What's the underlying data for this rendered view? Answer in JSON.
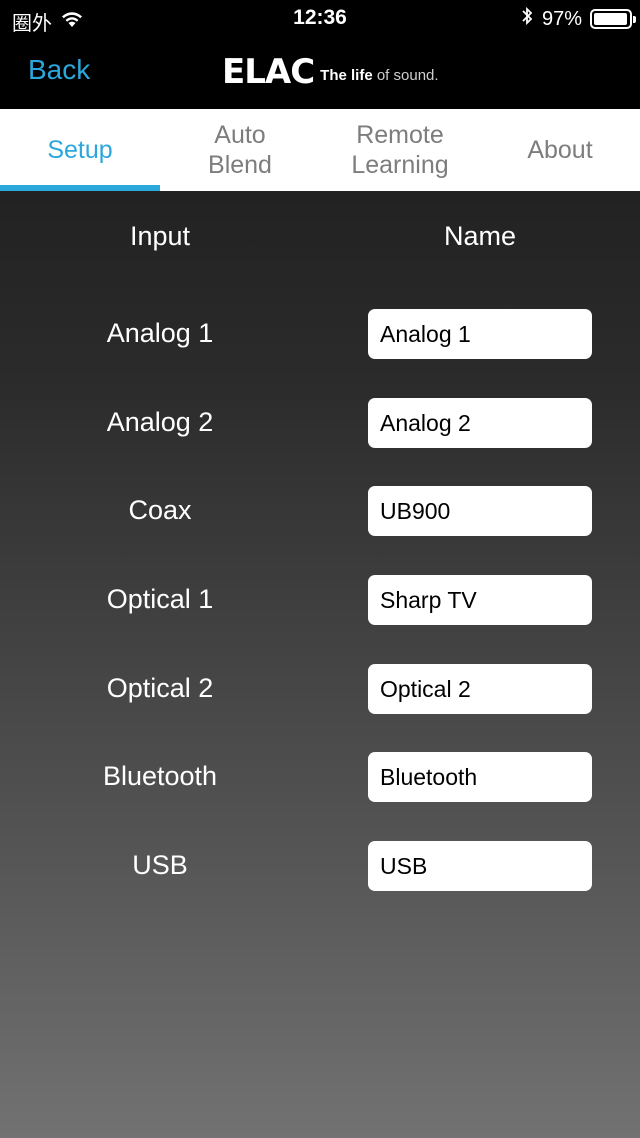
{
  "status": {
    "carrier": "圈外",
    "time": "12:36",
    "battery": "97%",
    "battery_level": 0.97
  },
  "nav": {
    "back_label": "Back",
    "logo_text": "ELAC",
    "logo_tagline_bold": "The life",
    "logo_tagline_rest": " of sound."
  },
  "tabs": [
    {
      "label": "Setup"
    },
    {
      "label": "Auto\nBlend"
    },
    {
      "label": "Remote\nLearning"
    },
    {
      "label": "About"
    }
  ],
  "table": {
    "col_input": "Input",
    "col_name": "Name",
    "rows": [
      {
        "input": "Analog 1",
        "name": "Analog 1"
      },
      {
        "input": "Analog 2",
        "name": "Analog 2"
      },
      {
        "input": "Coax",
        "name": "UB900"
      },
      {
        "input": "Optical 1",
        "name": "Sharp TV"
      },
      {
        "input": "Optical 2",
        "name": "Optical 2"
      },
      {
        "input": "Bluetooth",
        "name": "Bluetooth"
      },
      {
        "input": "USB",
        "name": "USB"
      }
    ]
  },
  "colors": {
    "accent": "#2ca7dc"
  }
}
